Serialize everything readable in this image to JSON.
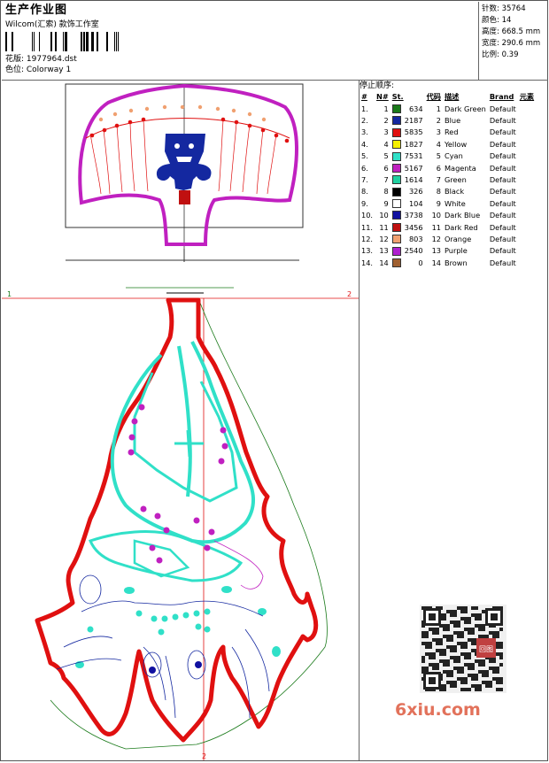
{
  "header": {
    "title": "生产作业图",
    "company": "Wilcom(汇索) 款饰工作室",
    "design_label": "花版: 1977964.dst",
    "colorway_label": "色位: Colorway 1"
  },
  "stats": {
    "stitches": "针数: 35764",
    "colors": "颜色: 14",
    "height": "高度: 668.5 mm",
    "width": "宽度: 290.6 mm",
    "scale": "比例: 0.39"
  },
  "legend": {
    "title": "停止顺序:",
    "headers": [
      "#",
      "N#",
      "St.",
      "代码",
      "描述",
      "Brand",
      "元素"
    ],
    "rows": [
      {
        "idx": "1.",
        "n": "1",
        "st": "634",
        "code": "1",
        "desc": "Dark Green",
        "brand": "Default",
        "color": "#1a7a1a"
      },
      {
        "idx": "2.",
        "n": "2",
        "st": "2187",
        "code": "2",
        "desc": "Blue",
        "brand": "Default",
        "color": "#1428a0"
      },
      {
        "idx": "3.",
        "n": "3",
        "st": "5835",
        "code": "3",
        "desc": "Red",
        "brand": "Default",
        "color": "#e01010"
      },
      {
        "idx": "4.",
        "n": "4",
        "st": "1827",
        "code": "4",
        "desc": "Yellow",
        "brand": "Default",
        "color": "#f5f000"
      },
      {
        "idx": "5.",
        "n": "5",
        "st": "7531",
        "code": "5",
        "desc": "Cyan",
        "brand": "Default",
        "color": "#30e0c8"
      },
      {
        "idx": "6.",
        "n": "6",
        "st": "5167",
        "code": "6",
        "desc": "Magenta",
        "brand": "Default",
        "color": "#c020c0"
      },
      {
        "idx": "7.",
        "n": "7",
        "st": "1614",
        "code": "7",
        "desc": "Green",
        "brand": "Default",
        "color": "#20d0a0"
      },
      {
        "idx": "8.",
        "n": "8",
        "st": "326",
        "code": "8",
        "desc": "Black",
        "brand": "Default",
        "color": "#000000"
      },
      {
        "idx": "9.",
        "n": "9",
        "st": "104",
        "code": "9",
        "desc": "White",
        "brand": "Default",
        "color": "#ffffff"
      },
      {
        "idx": "10.",
        "n": "10",
        "st": "3738",
        "code": "10",
        "desc": "Dark Blue",
        "brand": "Default",
        "color": "#1010a0"
      },
      {
        "idx": "11.",
        "n": "11",
        "st": "3456",
        "code": "11",
        "desc": "Dark Red",
        "brand": "Default",
        "color": "#c01010"
      },
      {
        "idx": "12.",
        "n": "12",
        "st": "803",
        "code": "12",
        "desc": "Orange",
        "brand": "Default",
        "color": "#f0a070"
      },
      {
        "idx": "13.",
        "n": "13",
        "st": "2540",
        "code": "13",
        "desc": "Purple",
        "brand": "Default",
        "color": "#b020d0"
      },
      {
        "idx": "14.",
        "n": "14",
        "st": "0",
        "code": "14",
        "desc": "Brown",
        "brand": "Default",
        "color": "#a06030"
      }
    ]
  },
  "markers": {
    "one": "1",
    "two": "2"
  },
  "watermark": {
    "site": "6xiu.com",
    "seal": "回图"
  }
}
